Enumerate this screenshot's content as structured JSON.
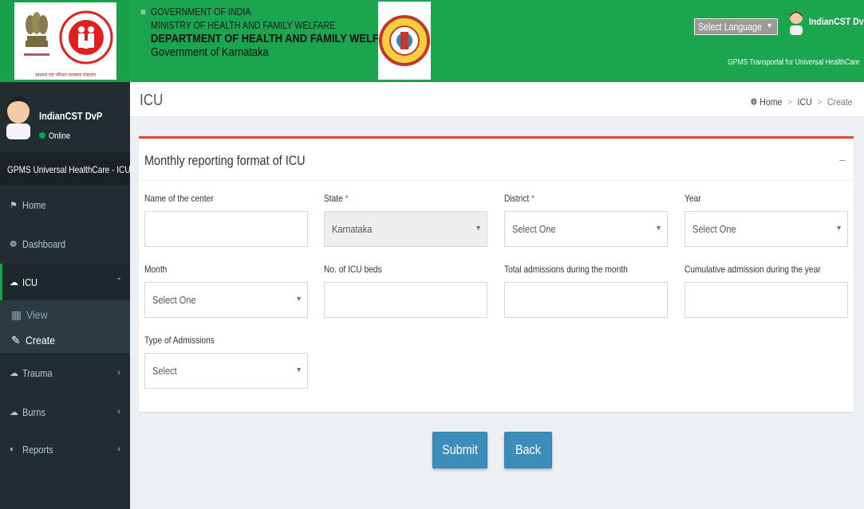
{
  "header": {
    "line1": "GOVERNMENT OF INDIA",
    "line2": "MINISTRY OF HEALTH AND FAMILY WELFARE",
    "line3": "DEPARTMENT OF HEALTH AND FAMILY WELFARE",
    "line4": "Government of Karnataka",
    "language_select": "Select Language",
    "user_name": "IndianCST DvP",
    "portal_tagline": "GPMS Transportal for Universal HealthCare",
    "logo_caption": "स्वास्थ्य एवं परिवार कल्याण मंत्रालय"
  },
  "sidebar": {
    "user_name": "IndianCST DvP",
    "status": "Online",
    "header": "GPMS Universal HealthCare - ICU",
    "items": [
      {
        "label": "Home",
        "icon": "home-icon"
      },
      {
        "label": "Dashboard",
        "icon": "dashboard-icon"
      },
      {
        "label": "ICU",
        "icon": "cloud-icon"
      },
      {
        "label": "Trauma",
        "icon": "cloud-icon"
      },
      {
        "label": "Burns",
        "icon": "cloud-icon"
      },
      {
        "label": "Reports",
        "icon": "pie-chart-icon"
      }
    ],
    "icu_sub": [
      {
        "label": "View",
        "icon": "table-icon"
      },
      {
        "label": "Create",
        "icon": "edit-icon"
      }
    ]
  },
  "content": {
    "page_title": "ICU",
    "breadcrumb": {
      "home": "Home",
      "section": "ICU",
      "current": "Create"
    }
  },
  "form": {
    "title": "Monthly reporting format of ICU",
    "fields": {
      "center_name": {
        "label": "Name of the center",
        "value": ""
      },
      "state": {
        "label": "State",
        "value": "Karnataka"
      },
      "district": {
        "label": "District",
        "value": "Select One"
      },
      "year": {
        "label": "Year",
        "value": "Select One"
      },
      "month": {
        "label": "Month",
        "value": "Select One"
      },
      "icu_beds": {
        "label": "No. of ICU beds",
        "value": ""
      },
      "total_admissions": {
        "label": "Total admissions during the month",
        "value": ""
      },
      "cumulative_admissions": {
        "label": "Cumulative admission during the year",
        "value": ""
      },
      "admission_type": {
        "label": "Type of Admissions",
        "value": "Select"
      }
    },
    "submit_label": "Submit",
    "back_label": "Back"
  },
  "colors": {
    "header_green": "#1aa54e",
    "sidebar_dark": "#222d32",
    "primary_button": "#3c8dbc",
    "box_accent": "#dd4b39"
  }
}
